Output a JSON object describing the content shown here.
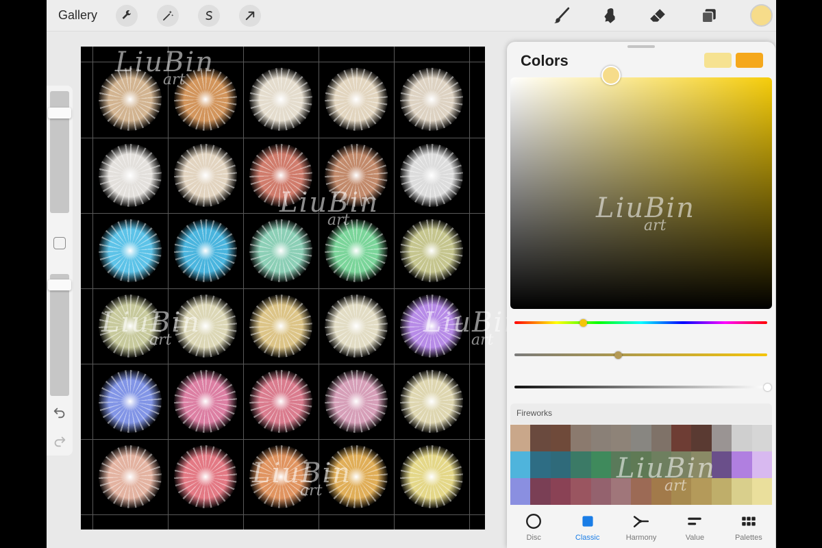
{
  "topbar": {
    "gallery_label": "Gallery",
    "left_tools": [
      {
        "name": "wrench-icon"
      },
      {
        "name": "magic-wand-icon"
      },
      {
        "name": "selection-icon"
      },
      {
        "name": "transform-arrow-icon"
      }
    ],
    "right_tools": [
      {
        "name": "brush-icon"
      },
      {
        "name": "smudge-icon"
      },
      {
        "name": "eraser-icon"
      },
      {
        "name": "layers-icon"
      }
    ],
    "current_color": "#f6dc8a"
  },
  "sidebar": {
    "brush_size_level": 0.15,
    "opacity_level": 0.05
  },
  "canvas": {
    "background": "#000000",
    "watermark_main": "LiuBin",
    "watermark_sub": "art",
    "bursts": [
      [
        "#d2b491",
        "#d2955c",
        "#e4dccd",
        "#e2d5bf",
        "#ddd2c2"
      ],
      [
        "#e3e0dc",
        "#e2d4c0",
        "#d07c6c",
        "#c28a6b",
        "#dcdcdc"
      ],
      [
        "#5dc3e8",
        "#4ab5de",
        "#8ccfb6",
        "#7bd59a",
        "#c5c58e"
      ],
      [
        "#c7c99c",
        "#dcd7b6",
        "#dcc487",
        "#e2dcc4",
        "#b78be7"
      ],
      [
        "#8295e6",
        "#dc7fa3",
        "#da7c8e",
        "#d69fb8",
        "#ded6b0"
      ],
      [
        "#e3b3a1",
        "#e37984",
        "#e09460",
        "#e0ae58",
        "#e4d788"
      ]
    ]
  },
  "colors": {
    "title": "Colors",
    "secondary_color": "#f6e291",
    "primary_color": "#f5a81c",
    "hue_level": 0.27,
    "saturation_level": 0.41,
    "brightness_level": 1.0,
    "palette": {
      "name": "Fireworks",
      "swatches": [
        "#c9a78a",
        "#6a4a3e",
        "#6f4a3a",
        "#8b7a6e",
        "#8a8077",
        "#8e8378",
        "#888681",
        "#7f7268",
        "#6e3d34",
        "#5a3a32",
        "#9a9493",
        "#cfcfcf",
        "#d6d6d6",
        "#4fb4dc",
        "#2e6d84",
        "#2f6a7a",
        "#3b7a66",
        "#3f8a5c",
        "#5a7a5a",
        "#5f7a55",
        "#6e7f5f",
        "#7a8262",
        "#8a8a66",
        "#6a4f8a",
        "#b07fe0",
        "#d8b9f0",
        "#8a8fe0",
        "#7a3f55",
        "#8a4255",
        "#9a5560",
        "#94626e",
        "#a0767a",
        "#9c6a55",
        "#a27a4a",
        "#a78a4f",
        "#b49a5a",
        "#bfae6a",
        "#d9cf8c",
        "#eadf9c"
      ]
    },
    "tabs": [
      {
        "label": "Disc",
        "icon": "disc-icon"
      },
      {
        "label": "Classic",
        "icon": "classic-square-icon"
      },
      {
        "label": "Harmony",
        "icon": "harmony-icon"
      },
      {
        "label": "Value",
        "icon": "value-sliders-icon"
      },
      {
        "label": "Palettes",
        "icon": "palettes-grid-icon"
      }
    ],
    "active_tab": "Classic"
  }
}
